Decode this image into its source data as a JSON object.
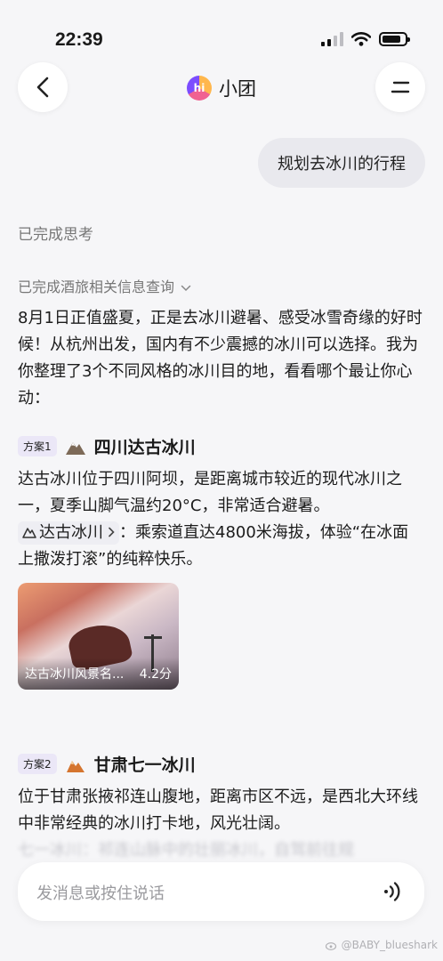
{
  "status": {
    "time": "22:39"
  },
  "nav": {
    "title": "小团",
    "logo_text": "hi"
  },
  "user_message": "规划去冰川的行程",
  "thinking_status": "已完成思考",
  "query_status": "已完成酒旅相关信息查询",
  "intro_text": "8月1日正值盛夏，正是去冰川避暑、感受冰雪奇缘的好时候！从杭州出发，国内有不少震撼的冰川可以选择。我为你整理了3个不同风格的冰川目的地，看看哪个最让你心动：",
  "options": [
    {
      "badge": "方案1",
      "title": "四川达古冰川",
      "desc": "达古冰川位于四川阿坝，是距离城市较近的现代冰川之一，夏季山脚气温约20°C，非常适合避暑。",
      "poi_tag": "达古冰川",
      "poi_desc": "：乘索道直达4800米海拔，体验“在冰面上撒泼打滚”的纯粹快乐。",
      "card": {
        "name": "达古冰川风景名...",
        "rating": "4.2分"
      }
    },
    {
      "badge": "方案2",
      "title": "甘肃七一冰川",
      "desc": "位于甘肃张掖祁连山腹地，距离市区不远，是西北大环线中非常经典的冰川打卡地，风光壮阔。",
      "faded": "七一冰川：祁连山脉中的壮丽冰川，自驾前往规"
    }
  ],
  "input": {
    "placeholder": "发消息或按住说话"
  },
  "watermark": "@BABY_blueshark"
}
